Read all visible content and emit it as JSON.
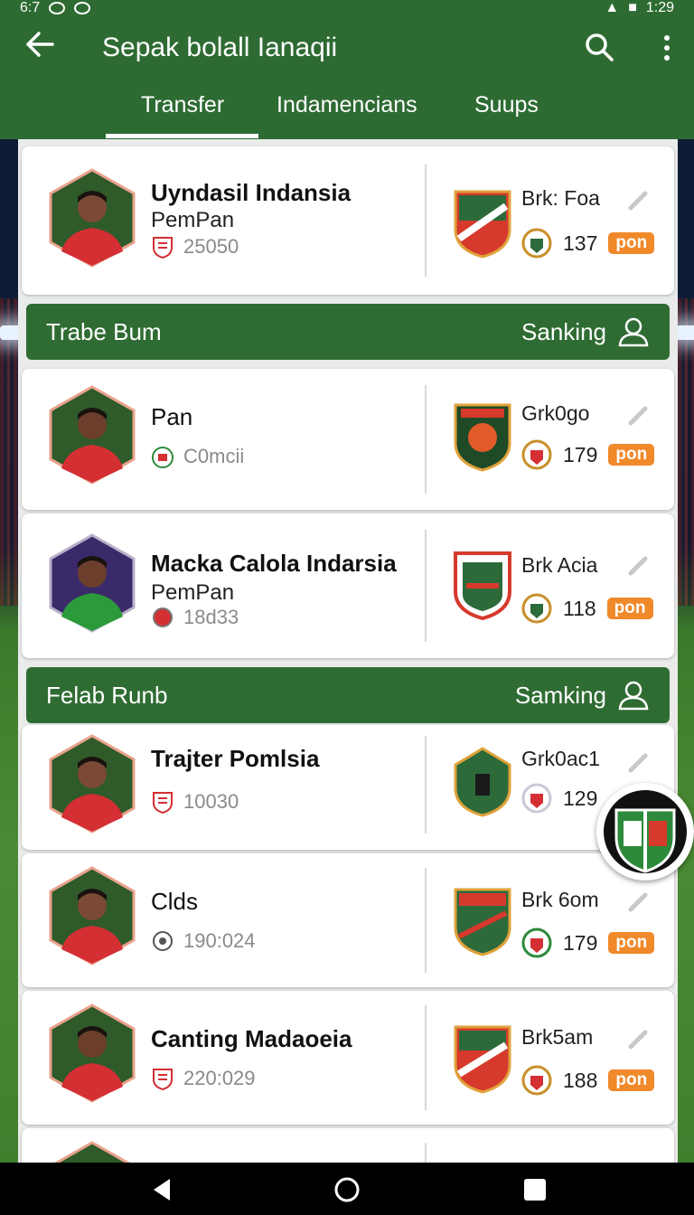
{
  "status_bar": {
    "time_left": "6:7",
    "time_right": "1:29"
  },
  "app_bar": {
    "title": "Sepak bolall Ianaqii",
    "tabs": [
      {
        "label": "Transfer",
        "active": true
      },
      {
        "label": "Indamencians",
        "active": false
      },
      {
        "label": "Suups",
        "active": false
      }
    ]
  },
  "cards": [
    {
      "name": "Uyndasil Indansia",
      "sub": "PemPan",
      "meta": "25050",
      "club": "Brk: Foa",
      "rating": "137",
      "pill": "pon",
      "jersey": "red"
    },
    {
      "name": "Pan",
      "sub": "",
      "meta": "C0mcii",
      "club": "Grk0go",
      "rating": "179",
      "pill": "pon",
      "jersey": "red"
    },
    {
      "name": "Macka Calola Indarsia",
      "sub": "PemPan",
      "meta": "18d33",
      "club": "Brk Acia",
      "rating": "118",
      "pill": "pon",
      "jersey": "green"
    },
    {
      "name": "Trajter Pomlsia",
      "sub": "",
      "meta": "10030",
      "club": "Grk0ac1",
      "rating": "129",
      "pill": "",
      "jersey": "red"
    },
    {
      "name": "Clds",
      "sub": "",
      "meta": "190:024",
      "club": "Brk 6om",
      "rating": "179",
      "pill": "pon",
      "jersey": "red"
    },
    {
      "name": "Canting Madaoeia",
      "sub": "",
      "meta": "220:029",
      "club": "Brk5am",
      "rating": "188",
      "pill": "pon",
      "jersey": "red"
    }
  ],
  "sections": [
    {
      "title": "Trabe Bum",
      "action": "Sanking"
    },
    {
      "title": "Felab Runb",
      "action": "Samking"
    }
  ],
  "colors": {
    "primary": "#2e6b33",
    "accent": "#f0892a",
    "card": "#ffffff"
  }
}
